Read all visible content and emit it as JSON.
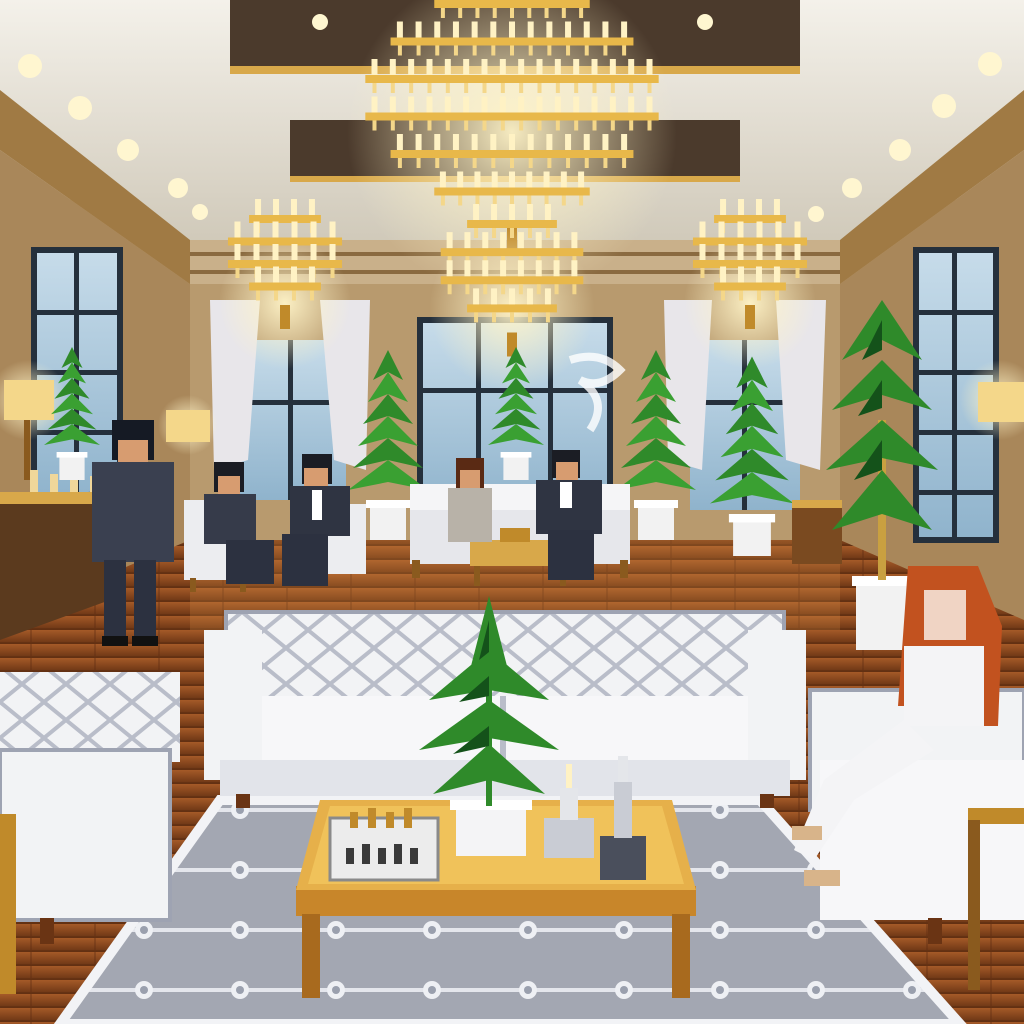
{
  "scene": {
    "palette": {
      "ceiling": "#e9e6df",
      "ceiling_recess": "#4a3a2e",
      "gold": "#e8b84a",
      "gold_dark": "#8a5a1e",
      "wood_floor": "#8b4a22",
      "wood_floor_light": "#b5682e",
      "window_glass": "#9fc3dc",
      "window_frame": "#2b3a4a",
      "wall": "#c7b08a",
      "sofa_white": "#f2f2f2",
      "sofa_shadow": "#b8bcc8",
      "plant_green": "#2f8a2a",
      "plant_dark": "#14521a",
      "rug": "#9ea2ad",
      "suit": "#2f3442",
      "skin": "#e0a77a",
      "hair_red": "#c2521f"
    }
  }
}
